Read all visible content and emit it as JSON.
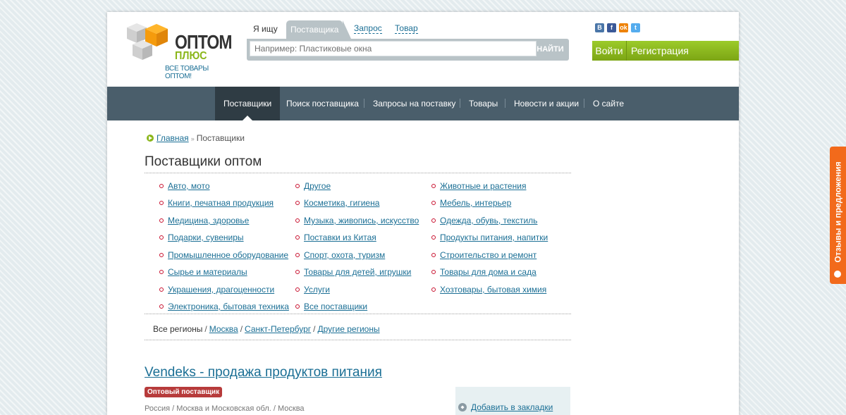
{
  "logo": {
    "line1": "ОПТОМ",
    "line2": "ПЛЮС",
    "tagline": "ВСЕ ТОВАРЫ ОПТОМ!"
  },
  "search": {
    "tabs": [
      {
        "label": "Я ищу"
      },
      {
        "label": "Поставщика"
      },
      {
        "label": "Запрос"
      },
      {
        "label": "Товар"
      }
    ],
    "placeholder": "Например: Пластиковые окна",
    "button": "НАЙТИ"
  },
  "socials": {
    "vk": "В",
    "fb": "f",
    "ok": "ok",
    "tw": "t"
  },
  "auth": {
    "login": "Войти",
    "register": "Регистрация"
  },
  "nav": [
    {
      "label": "Поставщики"
    },
    {
      "label": "Поиск поставщика"
    },
    {
      "label": "Запросы на поставку"
    },
    {
      "label": "Товары"
    },
    {
      "label": "Новости и акции"
    },
    {
      "label": "О сайте"
    }
  ],
  "breadcrumb": {
    "home": "Главная",
    "separator": "»",
    "current": "Поставщики"
  },
  "page_title": "Поставщики оптом",
  "categories": [
    "Авто, мото",
    "Другое",
    "Животные и растения",
    "Книги, печатная продукция",
    "Косметика, гигиена",
    "Мебель, интерьер",
    "Медицина, здоровье",
    "Музыка, живопись, искусство",
    "Одежда, обувь, текстиль",
    "Подарки, сувениры",
    "Поставки из Китая",
    "Продукты питания, напитки",
    "Промышленное оборудование",
    "Спорт, охота, туризм",
    "Строительство и ремонт",
    "Сырье и материалы",
    "Товары для детей, игрушки",
    "Товары для дома и сада",
    "Украшения, драгоценности",
    "Услуги",
    "Хозтовары, бытовая химия",
    "Электроника, бытовая техника",
    "Все поставщики"
  ],
  "regions": {
    "all": "Все регионы",
    "sep": "/",
    "moscow": "Москва",
    "spb": "Санкт-Петербург",
    "other": "Другие регионы"
  },
  "supplier": {
    "title": "Vendeks - продажа продуктов питания",
    "badge": "Оптовый поставщик",
    "location": "Россия / Москва и Московская обл. / Москва",
    "bookmark": "Добавить в закладки"
  },
  "feedback": "Отзывы и предложения"
}
